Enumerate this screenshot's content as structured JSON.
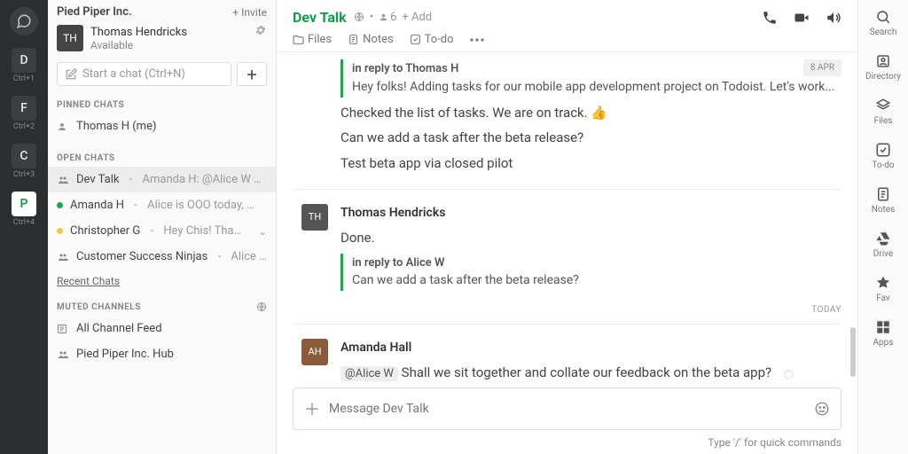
{
  "rail": {
    "items": [
      {
        "letter": "D",
        "hint": "Ctrl+1"
      },
      {
        "letter": "F",
        "hint": "Ctrl+2"
      },
      {
        "letter": "C",
        "hint": "Ctrl+3"
      },
      {
        "letter": "P",
        "hint": "Ctrl+4"
      }
    ]
  },
  "sidebar": {
    "org": "Pied Piper Inc.",
    "invite": "+ Invite",
    "profile_name": "Thomas Hendricks",
    "profile_status": "Available",
    "search_placeholder": "Start a chat (Ctrl+N)",
    "sections": {
      "pinned": "PINNED CHATS",
      "open": "OPEN CHATS",
      "muted": "MUTED CHANNELS"
    },
    "pinned": [
      {
        "label": "Thomas H (me)"
      }
    ],
    "open": [
      {
        "label": "Dev Talk",
        "preview": "Amanda H: @Alice W …"
      },
      {
        "label": "Amanda H",
        "preview": "Alice is OOO today, …"
      },
      {
        "label": "Christopher G",
        "preview": "Hey Chis! Tha…"
      },
      {
        "label": "Customer Success Ninjas",
        "preview": "Alice W:"
      }
    ],
    "recent": "Recent Chats",
    "muted": [
      {
        "label": "All Channel Feed"
      },
      {
        "label": "Pied Piper Inc. Hub"
      }
    ]
  },
  "header": {
    "title": "Dev Talk",
    "members": "6",
    "add": "+ Add",
    "tabs": {
      "files": "Files",
      "notes": "Notes",
      "todo": "To-do"
    }
  },
  "messages": {
    "m1": {
      "date": "8 APR",
      "reply_to": "in reply to Thomas H",
      "reply_body": "Hey folks! Adding tasks for our mobile app development project on Todoist. Let's work...",
      "line1": "Checked the list of tasks. We are on track. 👍",
      "line2": "Can we add a task after the beta release?",
      "line3": "Test beta app via closed pilot"
    },
    "m2": {
      "author": "Thomas Hendricks",
      "body": "Done.",
      "reply_to": "in reply to Alice W",
      "reply_body": "Can we add a task after the beta release?"
    },
    "daysep": "TODAY",
    "m3": {
      "author": "Amanda Hall",
      "mention": "@Alice W",
      "body": " Shall we sit together and collate our feedback on the beta app?"
    }
  },
  "composer": {
    "placeholder": "Message Dev Talk",
    "hint": "Type '/' for quick commands"
  },
  "rrail": {
    "items": [
      {
        "label": "Search"
      },
      {
        "label": "Directory"
      },
      {
        "label": "Files"
      },
      {
        "label": "To-do"
      },
      {
        "label": "Notes"
      },
      {
        "label": "Drive"
      },
      {
        "label": "Fav"
      },
      {
        "label": "Apps"
      }
    ]
  }
}
